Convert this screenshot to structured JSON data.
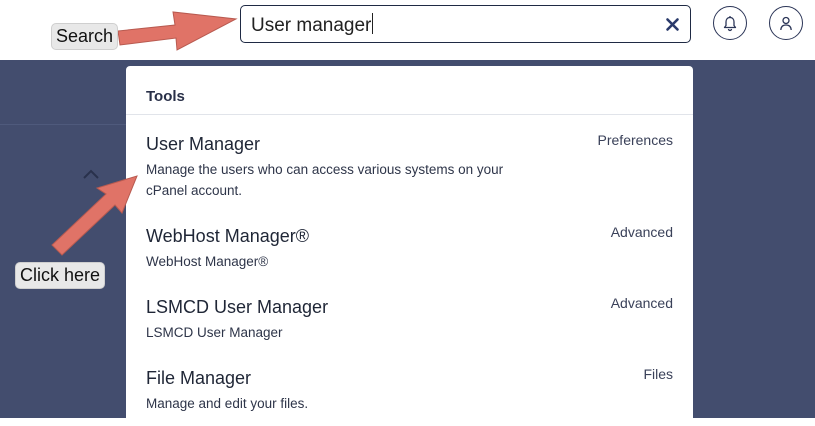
{
  "search": {
    "value": "User manager",
    "clear_icon": "close-icon"
  },
  "header_buttons": {
    "notifications_icon": "bell-icon",
    "account_icon": "user-icon"
  },
  "results": {
    "section_title": "Tools",
    "items": [
      {
        "title": "User Manager",
        "description": "Manage the users who can access various systems on your cPanel account.",
        "category": "Preferences"
      },
      {
        "title": "WebHost Manager®",
        "description": "WebHost Manager®",
        "category": "Advanced"
      },
      {
        "title": "LSMCD User Manager",
        "description": "LSMCD User Manager",
        "category": "Advanced"
      },
      {
        "title": "File Manager",
        "description": "Manage and edit your files.",
        "category": "Files"
      }
    ]
  },
  "annotations": {
    "search_label": "Search",
    "click_label": "Click here",
    "arrow_color": "#e07367"
  },
  "colors": {
    "background_dark": "#434d6e",
    "navy": "#2b3557"
  }
}
